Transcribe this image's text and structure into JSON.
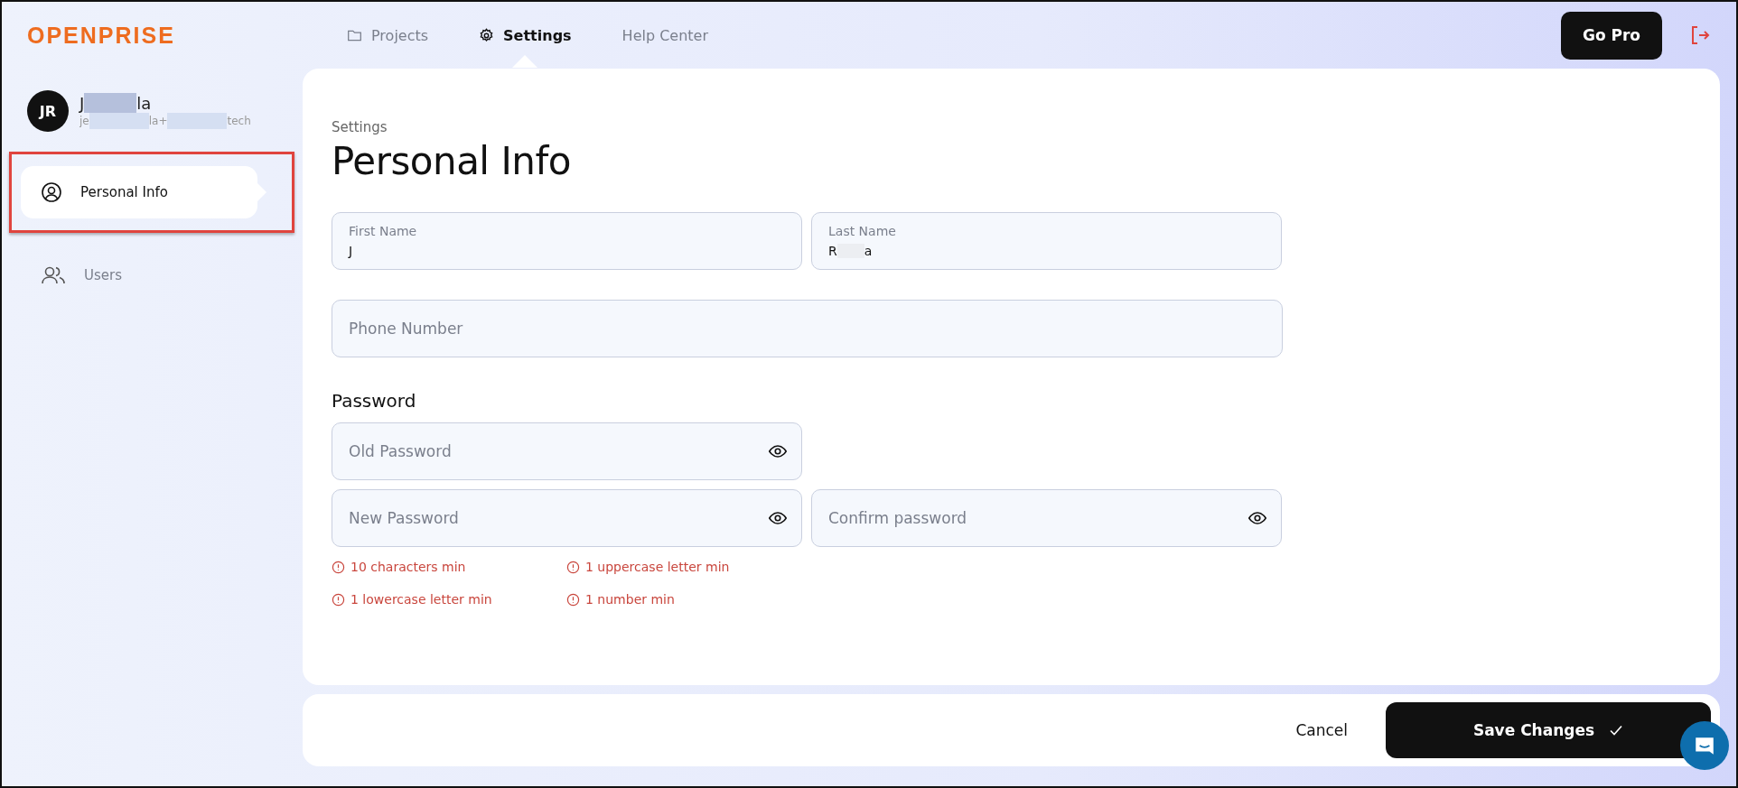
{
  "header": {
    "logo": "OPENPRISE",
    "nav": [
      {
        "label": "Projects",
        "selected": false
      },
      {
        "label": "Settings",
        "selected": true
      },
      {
        "label": "Help Center",
        "selected": false
      }
    ],
    "go_pro": "Go Pro"
  },
  "user": {
    "initials": "JR",
    "name": [
      {
        "kind": "text",
        "text": "J"
      },
      {
        "kind": "redacted"
      },
      {
        "kind": "text",
        "text": "la"
      }
    ],
    "email": [
      {
        "kind": "text",
        "text": "je"
      },
      {
        "kind": "redacted"
      },
      {
        "kind": "text",
        "text": "la+"
      },
      {
        "kind": "redacted"
      },
      {
        "kind": "text",
        "text": "tech"
      }
    ]
  },
  "sidebar": {
    "items": [
      {
        "label": "Personal Info",
        "selected": true,
        "annotated": true
      },
      {
        "label": "Users",
        "selected": false,
        "annotated": false
      }
    ]
  },
  "page": {
    "breadcrumb": "Settings",
    "title": "Personal Info",
    "name_fields": [
      {
        "label": "First Name",
        "value": [
          {
            "kind": "text",
            "text": "J"
          }
        ]
      },
      {
        "label": "Last Name",
        "value": [
          {
            "kind": "text",
            "text": "R"
          },
          {
            "kind": "redacted"
          },
          {
            "kind": "text",
            "text": "a"
          }
        ]
      }
    ],
    "phone": {
      "placeholder": "Phone Number"
    },
    "password_heading": "Password",
    "old_password": {
      "placeholder": "Old Password"
    },
    "new_passwords": [
      {
        "placeholder": "New Password"
      },
      {
        "placeholder": "Confirm password"
      }
    ],
    "rules": [
      "10 characters min",
      "1 uppercase letter min",
      "1 lowercase letter min",
      "1 number min"
    ]
  },
  "footer": {
    "cancel": "Cancel",
    "save": "Save Changes"
  }
}
